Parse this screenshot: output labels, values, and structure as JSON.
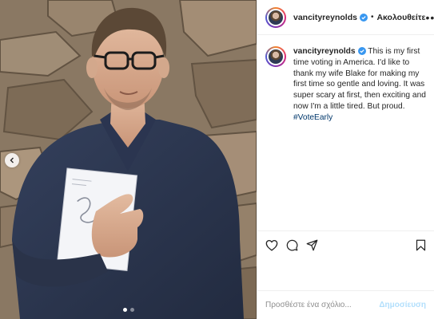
{
  "post": {
    "username": "vancityreynolds",
    "follow_label": "Ακολουθείτε",
    "separator": "•",
    "more_label": "•••",
    "caption_text": "This is my first time voting in America. I'd like to thank my wife Blake for making my first time so gentle and loving. It was super scary at first, then exciting and now I'm a little tired. But proud.",
    "hashtag": "#VoteEarly",
    "comment_placeholder": "Προσθέστε ένα σχόλιο...",
    "post_button_label": "Δημοσίευση",
    "carousel": {
      "count": 2,
      "active_index": 0
    }
  },
  "icons": {
    "verified": "verified-badge-icon",
    "like": "heart-icon",
    "comment": "comment-icon",
    "share": "share-icon",
    "save": "bookmark-icon",
    "prev": "chevron-left-icon"
  },
  "colors": {
    "verified_blue": "#3897f0",
    "link": "#00376b",
    "post_disabled": "#b2dffc",
    "muted": "#8e8e8e"
  }
}
